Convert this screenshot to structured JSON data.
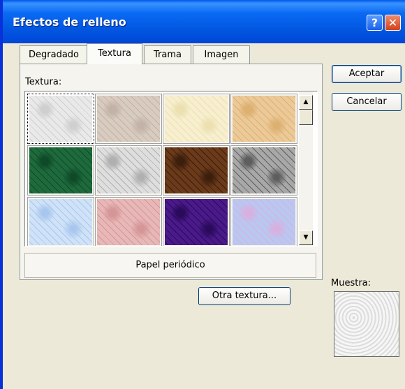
{
  "window": {
    "title": "Efectos de relleno",
    "help_button": "?",
    "close_button": "✕"
  },
  "tabs": [
    {
      "label": "Degradado",
      "active": false
    },
    {
      "label": "Textura",
      "active": true
    },
    {
      "label": "Trama",
      "active": false
    },
    {
      "label": "Imagen",
      "active": false
    }
  ],
  "textura_label": "Textura:",
  "selected_texture_name": "Papel periódico",
  "other_texture_button": "Otra textura...",
  "accept_button": "Aceptar",
  "cancel_button": "Cancelar",
  "sample_label": "Muestra:",
  "textures": [
    {
      "name": "newsprint-texture",
      "color": "#e9e9e9",
      "accent": "#cfcfcf"
    },
    {
      "name": "recycled-paper-texture",
      "color": "#d8cbbf",
      "accent": "#c2b3a6"
    },
    {
      "name": "parchment-texture",
      "color": "#f7efcf",
      "accent": "#ece0b0"
    },
    {
      "name": "stationery-texture",
      "color": "#ecc998",
      "accent": "#dcb070"
    },
    {
      "name": "green-marble-texture",
      "color": "#1e6a3c",
      "accent": "#0f4a28"
    },
    {
      "name": "white-marble-texture",
      "color": "#dedede",
      "accent": "#b0b0b0"
    },
    {
      "name": "brown-marble-texture",
      "color": "#6a3a1a",
      "accent": "#3c1e0c"
    },
    {
      "name": "granite-texture",
      "color": "#a8a8a8",
      "accent": "#5e5e5e"
    },
    {
      "name": "blue-tissue-paper-texture",
      "color": "#cfe2f7",
      "accent": "#a9c7ee"
    },
    {
      "name": "pink-tissue-paper-texture",
      "color": "#e8b7b7",
      "accent": "#d49696"
    },
    {
      "name": "purple-mesh-texture",
      "color": "#4a1a8a",
      "accent": "#2a0a5a"
    },
    {
      "name": "bouquet-texture",
      "color": "#b8c8f0",
      "accent": "#d8b0e0"
    }
  ]
}
